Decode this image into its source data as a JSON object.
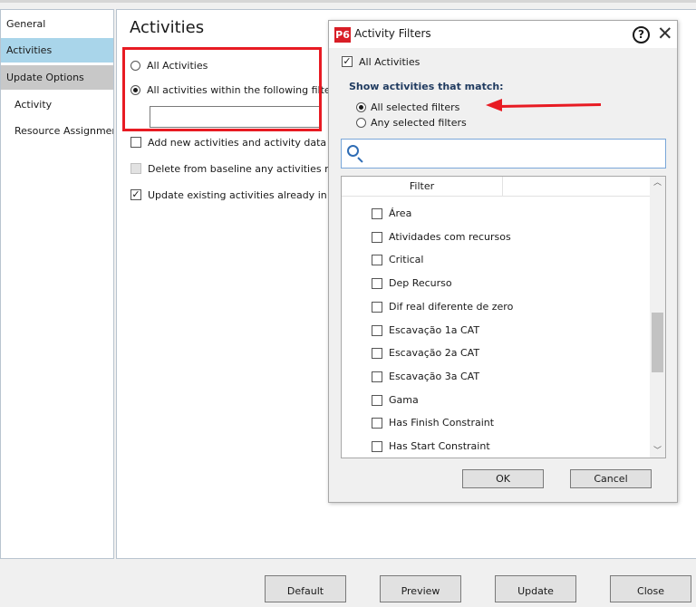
{
  "nav": {
    "items": [
      {
        "label": "General"
      },
      {
        "label": "Activities"
      },
      {
        "label": "Update Options"
      },
      {
        "label": "Activity"
      },
      {
        "label": "Resource Assignment"
      }
    ]
  },
  "main": {
    "title": "Activities",
    "radio_all": "All Activities",
    "radio_filter": "All activities within the following filter",
    "filter_value": "",
    "opt_add": "Add new activities and activity data (exce",
    "opt_delete": "Delete from baseline any activities no lon",
    "opt_update": "Update existing activities already in the b"
  },
  "dialog": {
    "logo": "P6",
    "title": "Activity Filters",
    "help": "?",
    "close": "✕",
    "all_activities_label": "All Activities",
    "match_heading": "Show activities that match:",
    "match_all": "All selected filters",
    "match_any": "Any selected filters",
    "search_value": "",
    "column_header": "Filter",
    "filters": [
      {
        "label": "Área",
        "checked": false
      },
      {
        "label": "Atividades com recursos",
        "checked": false
      },
      {
        "label": "Critical",
        "checked": false
      },
      {
        "label": "Dep Recurso",
        "checked": false
      },
      {
        "label": "Dif real diferente de zero",
        "checked": false
      },
      {
        "label": "Escavação 1a CAT",
        "checked": false
      },
      {
        "label": "Escavação 2a CAT",
        "checked": false
      },
      {
        "label": "Escavação 3a CAT",
        "checked": false
      },
      {
        "label": "Gama",
        "checked": false
      },
      {
        "label": "Has Finish Constraint",
        "checked": false
      },
      {
        "label": "Has Start Constraint",
        "checked": false
      }
    ],
    "ok_label": "OK",
    "cancel_label": "Cancel"
  },
  "footer": {
    "default_label": "Default",
    "preview_label": "Preview",
    "update_label": "Update",
    "close_label": "Close"
  },
  "colors": {
    "selected_nav": "#a9d5ea",
    "annotation_red": "#e81b23",
    "p6_red": "#d81e26",
    "heading_blue": "#1f3a5f"
  }
}
